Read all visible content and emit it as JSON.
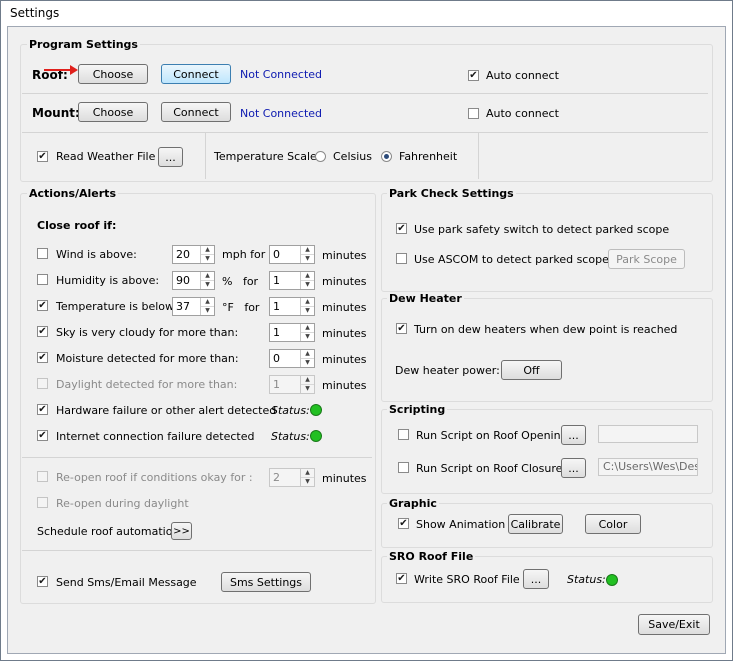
{
  "window": {
    "title": "Settings"
  },
  "program": {
    "title": "Program Settings",
    "roof": {
      "label": "Roof:",
      "choose": "Choose",
      "connect": "Connect",
      "status": "Not Connected",
      "auto_connect": "Auto connect",
      "auto_checked": true
    },
    "mount": {
      "label": "Mount:",
      "choose": "Choose",
      "connect": "Connect",
      "status": "Not Connected",
      "auto_connect": "Auto connect",
      "auto_checked": false
    },
    "weather": {
      "label": "Read Weather File",
      "browse": "...",
      "checked": true
    },
    "temp_scale": {
      "label": "Temperature Scale:",
      "celsius": "Celsius",
      "fahrenheit": "Fahrenheit",
      "selected": "Fahrenheit"
    }
  },
  "actions": {
    "title": "Actions/Alerts",
    "close_if": "Close roof if:",
    "rows": [
      {
        "label": "Wind is above:",
        "checked": false,
        "v1": "20",
        "unit": "mph for",
        "v2": "0",
        "suffix": "minutes"
      },
      {
        "label": "Humidity is above:",
        "checked": false,
        "v1": "90",
        "unit": "%   for",
        "v2": "1",
        "suffix": "minutes"
      },
      {
        "label": "Temperature is below:",
        "checked": true,
        "v1": "37",
        "unit": "°F   for",
        "v2": "1",
        "suffix": "minutes"
      },
      {
        "label": "Sky is very cloudy for more than:",
        "checked": true,
        "v2": "1",
        "suffix": "minutes"
      },
      {
        "label": "Moisture detected for more than:",
        "checked": true,
        "v2": "0",
        "suffix": "minutes"
      },
      {
        "label": "Daylight detected for more than:",
        "checked": false,
        "v2": "1",
        "suffix": "minutes"
      },
      {
        "label": "Hardware failure or other alert detected",
        "checked": true,
        "status": "Status:"
      },
      {
        "label": "Internet connection failure detected",
        "checked": true,
        "status": "Status:"
      }
    ],
    "reopen": {
      "label": "Re-open roof if conditions okay for :",
      "value": "2",
      "suffix": "minutes"
    },
    "reopen_daylight": "Re-open during daylight",
    "schedule": {
      "label": "Schedule roof automation:",
      "button": ">>"
    }
  },
  "sms": {
    "label": "Send Sms/Email Message",
    "checked": true,
    "button": "Sms Settings"
  },
  "park": {
    "title": "Park Check Settings",
    "safety_switch": "Use park safety switch to detect parked scope",
    "safety_checked": true,
    "ascom": "Use ASCOM to detect parked scope",
    "ascom_checked": false,
    "park_scope": "Park Scope"
  },
  "dew": {
    "title": "Dew Heater",
    "turn_on": "Turn on dew heaters when dew point is reached",
    "turn_on_checked": true,
    "power_label": "Dew heater power:",
    "power_button": "Off"
  },
  "scripting": {
    "title": "Scripting",
    "opening": "Run Script on Roof Opening",
    "closure": "Run Script on Roof Closure",
    "browse": "...",
    "opening_path": "",
    "closure_path": "C:\\Users\\Wes\\Des"
  },
  "graphic": {
    "title": "Graphic",
    "show_animation": "Show Animation",
    "checked": true,
    "calibrate": "Calibrate",
    "color": "Color"
  },
  "sro": {
    "title": "SRO Roof File",
    "write": "Write SRO Roof File",
    "checked": true,
    "browse": "...",
    "status": "Status:"
  },
  "save_exit": "Save/Exit",
  "colors": {
    "led_green": "#22c022",
    "link_blue": "#0d1ab0",
    "arrow_red": "#e0201c"
  }
}
